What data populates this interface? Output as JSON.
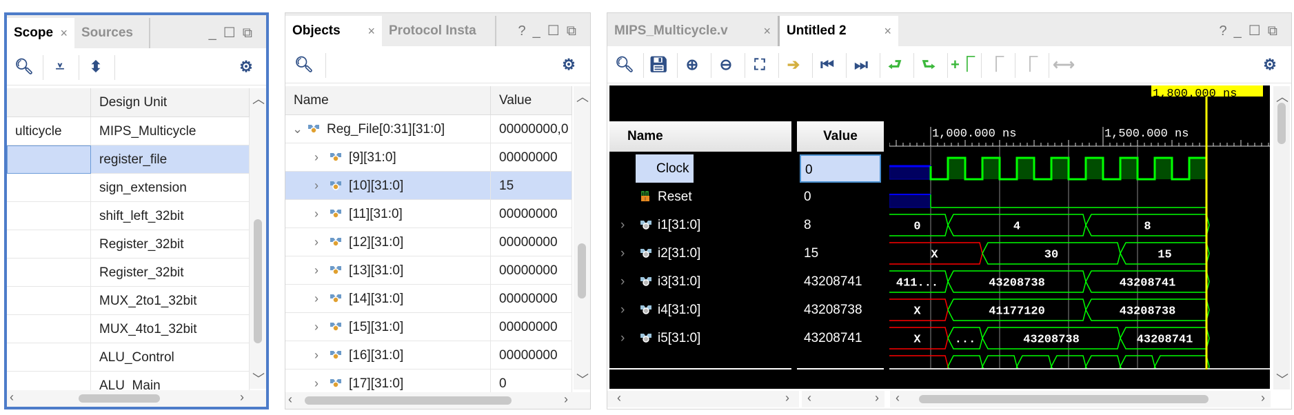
{
  "scope_panel": {
    "tabs": [
      {
        "label": "Scope",
        "active": true
      },
      {
        "label": "Sources",
        "active": false
      }
    ],
    "columns": [
      "",
      "Design Unit"
    ],
    "rows": [
      {
        "name": "ulticycle",
        "unit": "MIPS_Multicycle"
      },
      {
        "name": "",
        "unit": "register_file",
        "selected": true
      },
      {
        "name": "",
        "unit": "sign_extension"
      },
      {
        "name": "",
        "unit": "shift_left_32bit"
      },
      {
        "name": "",
        "unit": "Register_32bit"
      },
      {
        "name": "",
        "unit": "Register_32bit"
      },
      {
        "name": "",
        "unit": "MUX_2to1_32bit"
      },
      {
        "name": "",
        "unit": "MUX_4to1_32bit"
      },
      {
        "name": "",
        "unit": "ALU_Control"
      },
      {
        "name": "",
        "unit": "ALU_Main"
      }
    ],
    "toolbar": [
      "search-icon",
      "collapse-all-icon",
      "expand-all-icon",
      "gear-icon"
    ]
  },
  "objects_panel": {
    "tabs": [
      {
        "label": "Objects",
        "active": true
      },
      {
        "label": "Protocol Insta",
        "active": false
      }
    ],
    "columns": [
      "Name",
      "Value"
    ],
    "rows": [
      {
        "name": "Reg_File[0:31][31:0]",
        "value": "00000000,0",
        "expanded": true,
        "level": 0
      },
      {
        "name": "[9][31:0]",
        "value": "00000000",
        "level": 1
      },
      {
        "name": "[10][31:0]",
        "value": "15",
        "level": 1,
        "selected": true
      },
      {
        "name": "[11][31:0]",
        "value": "00000000",
        "level": 1
      },
      {
        "name": "[12][31:0]",
        "value": "00000000",
        "level": 1
      },
      {
        "name": "[13][31:0]",
        "value": "00000000",
        "level": 1
      },
      {
        "name": "[14][31:0]",
        "value": "00000000",
        "level": 1
      },
      {
        "name": "[15][31:0]",
        "value": "00000000",
        "level": 1
      },
      {
        "name": "[16][31:0]",
        "value": "00000000",
        "level": 1
      },
      {
        "name": "[17][31:0]",
        "value": "0",
        "level": 1
      }
    ]
  },
  "wave_panel": {
    "tabs": [
      {
        "label": "MIPS_Multicycle.v",
        "active": false
      },
      {
        "label": "Untitled 2",
        "active": true
      }
    ],
    "name_header": "Name",
    "value_header": "Value",
    "cursor_label": "1,800.000 ns",
    "cursor_time": 1800,
    "time_labels": [
      {
        "t": 1000,
        "label": "1,000.000 ns"
      },
      {
        "t": 1500,
        "label": "1,500.000 ns"
      }
    ],
    "view_range_ns": [
      880,
      2000
    ],
    "colors": {
      "bus": "#00ff00",
      "undefined": "#ff0000",
      "clock_fill": "#004d00",
      "highz": "#0000ff",
      "cursor": "#ffff00"
    },
    "signals": [
      {
        "name": "Clock",
        "value": "0",
        "type": "bit",
        "clock": {
          "start": 1000,
          "period": 100,
          "first_rise": 1050
        },
        "selected": true
      },
      {
        "name": "Reset",
        "value": "0",
        "type": "bit"
      },
      {
        "name": "i1[31:0]",
        "value": "8",
        "type": "bus",
        "segments": [
          {
            "s": 880,
            "e": 1050,
            "v": "0"
          },
          {
            "s": 1050,
            "e": 1450,
            "v": "4"
          },
          {
            "s": 1450,
            "e": 1800,
            "v": "8"
          }
        ]
      },
      {
        "name": "i2[31:0]",
        "value": "15",
        "type": "bus",
        "segments": [
          {
            "s": 880,
            "e": 1150,
            "v": "X",
            "x": true
          },
          {
            "s": 1150,
            "e": 1550,
            "v": "30"
          },
          {
            "s": 1550,
            "e": 1800,
            "v": "15"
          }
        ]
      },
      {
        "name": "i3[31:0]",
        "value": "43208741",
        "type": "bus",
        "segments": [
          {
            "s": 880,
            "e": 1050,
            "v": "411..."
          },
          {
            "s": 1050,
            "e": 1450,
            "v": "43208738"
          },
          {
            "s": 1450,
            "e": 1800,
            "v": "43208741"
          }
        ]
      },
      {
        "name": "i4[31:0]",
        "value": "43208738",
        "type": "bus",
        "segments": [
          {
            "s": 880,
            "e": 1050,
            "v": "X",
            "x": true
          },
          {
            "s": 1050,
            "e": 1450,
            "v": "41177120"
          },
          {
            "s": 1450,
            "e": 1800,
            "v": "43208738"
          }
        ]
      },
      {
        "name": "i5[31:0]",
        "value": "43208741",
        "type": "bus",
        "segments": [
          {
            "s": 880,
            "e": 1050,
            "v": "X",
            "x": true
          },
          {
            "s": 1050,
            "e": 1150,
            "v": "..."
          },
          {
            "s": 1150,
            "e": 1550,
            "v": "43208738"
          },
          {
            "s": 1550,
            "e": 1800,
            "v": "43208741"
          }
        ]
      },
      {
        "name": "",
        "value": "",
        "type": "bus",
        "segments": [
          {
            "s": 880,
            "e": 1050,
            "v": "",
            "x": true
          },
          {
            "s": 1050,
            "e": 1150,
            "v": ""
          },
          {
            "s": 1150,
            "e": 1250,
            "v": ""
          },
          {
            "s": 1250,
            "e": 1350,
            "v": ""
          },
          {
            "s": 1350,
            "e": 1450,
            "v": ""
          },
          {
            "s": 1450,
            "e": 1550,
            "v": ""
          },
          {
            "s": 1550,
            "e": 1650,
            "v": ""
          },
          {
            "s": 1650,
            "e": 1800,
            "v": ""
          }
        ]
      }
    ],
    "toolbar": [
      "search-icon",
      "save-icon",
      "zoom-in-icon",
      "zoom-out-icon",
      "zoom-fit-icon",
      "go-to-cursor-icon",
      "go-to-start-icon",
      "go-to-end-icon",
      "previous-transition-icon",
      "next-transition-icon",
      "add-marker-icon",
      "previous-marker-icon",
      "next-marker-icon",
      "swap-cursors-icon",
      "gear-icon"
    ]
  }
}
